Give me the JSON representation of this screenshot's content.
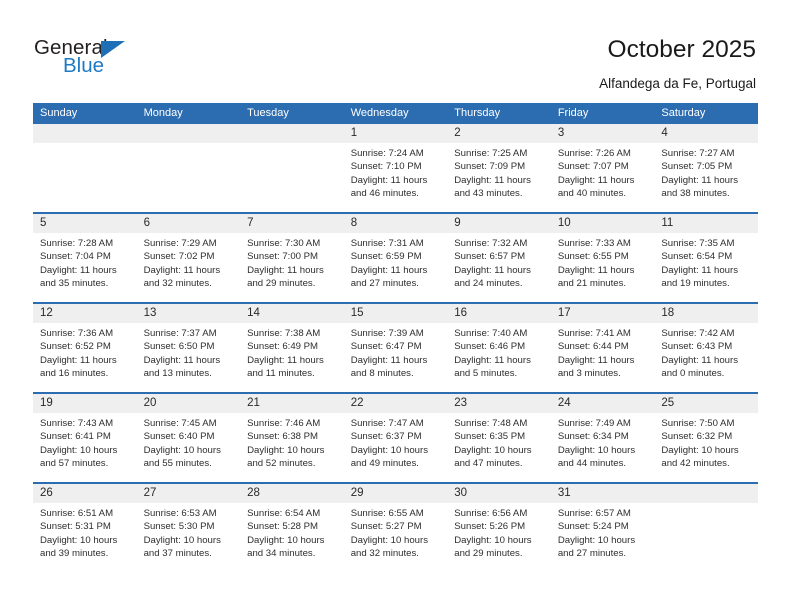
{
  "brand": {
    "name_top": "General",
    "name_bottom": "Blue",
    "accent_color": "#1f7ac4",
    "triangle_color": "#1f6fb6"
  },
  "header": {
    "title": "October 2025",
    "location": "Alfandega da Fe, Portugal"
  },
  "theme": {
    "header_bg": "#2c6cb0",
    "header_text": "#ffffff",
    "daynum_bg": "#efefef",
    "cell_bg": "#ffffff",
    "separator": "#2c6cb0"
  },
  "weekday_headers": [
    "Sunday",
    "Monday",
    "Tuesday",
    "Wednesday",
    "Thursday",
    "Friday",
    "Saturday"
  ],
  "labels": {
    "sunrise": "Sunrise:",
    "sunset": "Sunset:",
    "daylight": "Daylight:"
  },
  "weeks": [
    [
      {
        "day": "",
        "empty": true
      },
      {
        "day": "",
        "empty": true
      },
      {
        "day": "",
        "empty": true
      },
      {
        "day": "1",
        "sunrise": "Sunrise: 7:24 AM",
        "sunset": "Sunset: 7:10 PM",
        "daylight_1": "Daylight: 11 hours",
        "daylight_2": "and 46 minutes."
      },
      {
        "day": "2",
        "sunrise": "Sunrise: 7:25 AM",
        "sunset": "Sunset: 7:09 PM",
        "daylight_1": "Daylight: 11 hours",
        "daylight_2": "and 43 minutes."
      },
      {
        "day": "3",
        "sunrise": "Sunrise: 7:26 AM",
        "sunset": "Sunset: 7:07 PM",
        "daylight_1": "Daylight: 11 hours",
        "daylight_2": "and 40 minutes."
      },
      {
        "day": "4",
        "sunrise": "Sunrise: 7:27 AM",
        "sunset": "Sunset: 7:05 PM",
        "daylight_1": "Daylight: 11 hours",
        "daylight_2": "and 38 minutes."
      }
    ],
    [
      {
        "day": "5",
        "sunrise": "Sunrise: 7:28 AM",
        "sunset": "Sunset: 7:04 PM",
        "daylight_1": "Daylight: 11 hours",
        "daylight_2": "and 35 minutes."
      },
      {
        "day": "6",
        "sunrise": "Sunrise: 7:29 AM",
        "sunset": "Sunset: 7:02 PM",
        "daylight_1": "Daylight: 11 hours",
        "daylight_2": "and 32 minutes."
      },
      {
        "day": "7",
        "sunrise": "Sunrise: 7:30 AM",
        "sunset": "Sunset: 7:00 PM",
        "daylight_1": "Daylight: 11 hours",
        "daylight_2": "and 29 minutes."
      },
      {
        "day": "8",
        "sunrise": "Sunrise: 7:31 AM",
        "sunset": "Sunset: 6:59 PM",
        "daylight_1": "Daylight: 11 hours",
        "daylight_2": "and 27 minutes."
      },
      {
        "day": "9",
        "sunrise": "Sunrise: 7:32 AM",
        "sunset": "Sunset: 6:57 PM",
        "daylight_1": "Daylight: 11 hours",
        "daylight_2": "and 24 minutes."
      },
      {
        "day": "10",
        "sunrise": "Sunrise: 7:33 AM",
        "sunset": "Sunset: 6:55 PM",
        "daylight_1": "Daylight: 11 hours",
        "daylight_2": "and 21 minutes."
      },
      {
        "day": "11",
        "sunrise": "Sunrise: 7:35 AM",
        "sunset": "Sunset: 6:54 PM",
        "daylight_1": "Daylight: 11 hours",
        "daylight_2": "and 19 minutes."
      }
    ],
    [
      {
        "day": "12",
        "sunrise": "Sunrise: 7:36 AM",
        "sunset": "Sunset: 6:52 PM",
        "daylight_1": "Daylight: 11 hours",
        "daylight_2": "and 16 minutes."
      },
      {
        "day": "13",
        "sunrise": "Sunrise: 7:37 AM",
        "sunset": "Sunset: 6:50 PM",
        "daylight_1": "Daylight: 11 hours",
        "daylight_2": "and 13 minutes."
      },
      {
        "day": "14",
        "sunrise": "Sunrise: 7:38 AM",
        "sunset": "Sunset: 6:49 PM",
        "daylight_1": "Daylight: 11 hours",
        "daylight_2": "and 11 minutes."
      },
      {
        "day": "15",
        "sunrise": "Sunrise: 7:39 AM",
        "sunset": "Sunset: 6:47 PM",
        "daylight_1": "Daylight: 11 hours",
        "daylight_2": "and 8 minutes."
      },
      {
        "day": "16",
        "sunrise": "Sunrise: 7:40 AM",
        "sunset": "Sunset: 6:46 PM",
        "daylight_1": "Daylight: 11 hours",
        "daylight_2": "and 5 minutes."
      },
      {
        "day": "17",
        "sunrise": "Sunrise: 7:41 AM",
        "sunset": "Sunset: 6:44 PM",
        "daylight_1": "Daylight: 11 hours",
        "daylight_2": "and 3 minutes."
      },
      {
        "day": "18",
        "sunrise": "Sunrise: 7:42 AM",
        "sunset": "Sunset: 6:43 PM",
        "daylight_1": "Daylight: 11 hours",
        "daylight_2": "and 0 minutes."
      }
    ],
    [
      {
        "day": "19",
        "sunrise": "Sunrise: 7:43 AM",
        "sunset": "Sunset: 6:41 PM",
        "daylight_1": "Daylight: 10 hours",
        "daylight_2": "and 57 minutes."
      },
      {
        "day": "20",
        "sunrise": "Sunrise: 7:45 AM",
        "sunset": "Sunset: 6:40 PM",
        "daylight_1": "Daylight: 10 hours",
        "daylight_2": "and 55 minutes."
      },
      {
        "day": "21",
        "sunrise": "Sunrise: 7:46 AM",
        "sunset": "Sunset: 6:38 PM",
        "daylight_1": "Daylight: 10 hours",
        "daylight_2": "and 52 minutes."
      },
      {
        "day": "22",
        "sunrise": "Sunrise: 7:47 AM",
        "sunset": "Sunset: 6:37 PM",
        "daylight_1": "Daylight: 10 hours",
        "daylight_2": "and 49 minutes."
      },
      {
        "day": "23",
        "sunrise": "Sunrise: 7:48 AM",
        "sunset": "Sunset: 6:35 PM",
        "daylight_1": "Daylight: 10 hours",
        "daylight_2": "and 47 minutes."
      },
      {
        "day": "24",
        "sunrise": "Sunrise: 7:49 AM",
        "sunset": "Sunset: 6:34 PM",
        "daylight_1": "Daylight: 10 hours",
        "daylight_2": "and 44 minutes."
      },
      {
        "day": "25",
        "sunrise": "Sunrise: 7:50 AM",
        "sunset": "Sunset: 6:32 PM",
        "daylight_1": "Daylight: 10 hours",
        "daylight_2": "and 42 minutes."
      }
    ],
    [
      {
        "day": "26",
        "sunrise": "Sunrise: 6:51 AM",
        "sunset": "Sunset: 5:31 PM",
        "daylight_1": "Daylight: 10 hours",
        "daylight_2": "and 39 minutes."
      },
      {
        "day": "27",
        "sunrise": "Sunrise: 6:53 AM",
        "sunset": "Sunset: 5:30 PM",
        "daylight_1": "Daylight: 10 hours",
        "daylight_2": "and 37 minutes."
      },
      {
        "day": "28",
        "sunrise": "Sunrise: 6:54 AM",
        "sunset": "Sunset: 5:28 PM",
        "daylight_1": "Daylight: 10 hours",
        "daylight_2": "and 34 minutes."
      },
      {
        "day": "29",
        "sunrise": "Sunrise: 6:55 AM",
        "sunset": "Sunset: 5:27 PM",
        "daylight_1": "Daylight: 10 hours",
        "daylight_2": "and 32 minutes."
      },
      {
        "day": "30",
        "sunrise": "Sunrise: 6:56 AM",
        "sunset": "Sunset: 5:26 PM",
        "daylight_1": "Daylight: 10 hours",
        "daylight_2": "and 29 minutes."
      },
      {
        "day": "31",
        "sunrise": "Sunrise: 6:57 AM",
        "sunset": "Sunset: 5:24 PM",
        "daylight_1": "Daylight: 10 hours",
        "daylight_2": "and 27 minutes."
      },
      {
        "day": "",
        "empty": true
      }
    ]
  ]
}
